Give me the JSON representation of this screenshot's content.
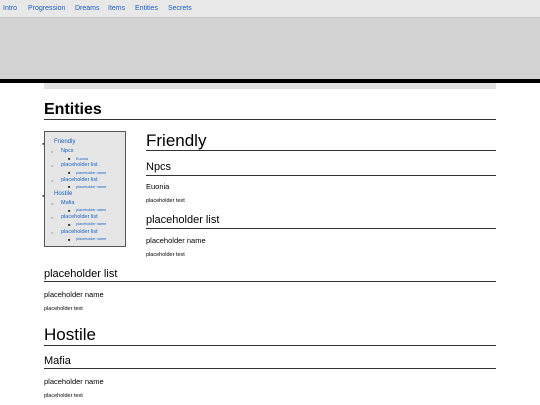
{
  "nav": {
    "items": [
      "Intro",
      "Progression",
      "Dreams",
      "Items",
      "Entities",
      "Secrets"
    ]
  },
  "page": {
    "title": "Entities"
  },
  "toc": {
    "friendly": "Friendly",
    "npcs": "Npcs",
    "euonia": "Euonia",
    "pl1": "placeholder list",
    "pn1": "placeholder name",
    "pl2": "placeholder list",
    "pn2": "placeholder name",
    "hostile": "Hostile",
    "mafia": "Mafia",
    "pn3": "placeholder name",
    "pl3": "placeholder list",
    "pn4": "placeholder name",
    "pl4": "placeholder list",
    "pn5": "placeholder name"
  },
  "content": {
    "friendly_heading": "Friendly",
    "npcs_heading": "Npcs",
    "euonia_name": "Euonia",
    "euonia_text": "placeholder text",
    "list1_heading": "placeholder list",
    "list1_name": "placeholder name",
    "list1_text": "placeholder text",
    "list2_heading": "placeholder list",
    "list2_name": "placeholder name",
    "list2_text": "placeholder text",
    "hostile_heading": "Hostile",
    "mafia_heading": "Mafia",
    "mafia_name": "placeholder name",
    "mafia_text": "placeholder text"
  },
  "colors": {
    "link": "#1a5fc8",
    "banner": "#d3d3d3",
    "toc_bg": "#e6e6e6"
  }
}
